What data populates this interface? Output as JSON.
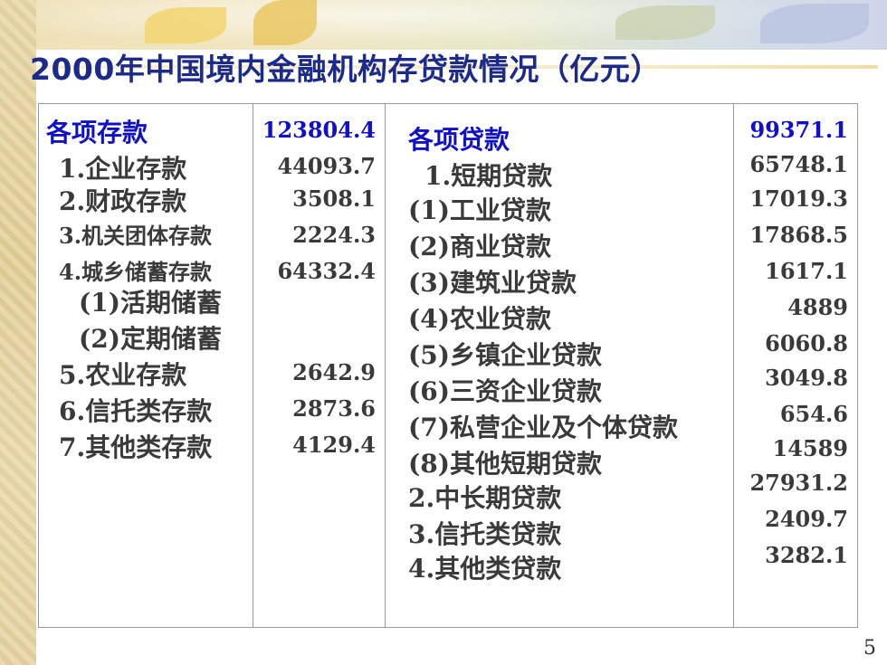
{
  "slide": {
    "title": "2000年中国境内金融机构存贷款情况（亿元）",
    "page_number": "5"
  },
  "deposits": {
    "rows": [
      {
        "label": "各项存款",
        "value": "123804.4",
        "style": "header"
      },
      {
        "label": "1.企业存款",
        "value": "44093.7",
        "style": "normal"
      },
      {
        "label": "2.财政存款",
        "value": "3508.1",
        "style": "normal"
      },
      {
        "label": "3.机关团体存款",
        "value": "2224.3",
        "style": "normal"
      },
      {
        "label": "4.城乡储蓄存款",
        "value": "64332.4",
        "style": "normal"
      },
      {
        "label": "(1)活期储蓄",
        "value": "",
        "style": "normal"
      },
      {
        "label": "(2)定期储蓄",
        "value": "",
        "style": "normal"
      },
      {
        "label": "5.农业存款",
        "value": "2642.9",
        "style": "normal"
      },
      {
        "label": "6.信托类存款",
        "value": "2873.6",
        "style": "normal"
      },
      {
        "label": "7.其他类存款",
        "value": "4129.4",
        "style": "normal"
      }
    ]
  },
  "loans": {
    "rows": [
      {
        "label": "各项贷款",
        "value": "99371.1",
        "style": "header"
      },
      {
        "label": "1.短期贷款",
        "value": "65748.1",
        "style": "normal"
      },
      {
        "label": "(1)工业贷款",
        "value": "17019.3",
        "style": "normal"
      },
      {
        "label": "(2)商业贷款",
        "value": "17868.5",
        "style": "normal"
      },
      {
        "label": "(3)建筑业贷款",
        "value": "1617.1",
        "style": "normal"
      },
      {
        "label": "(4)农业贷款",
        "value": "4889",
        "style": "normal"
      },
      {
        "label": "(5)乡镇企业贷款",
        "value": "6060.8",
        "style": "normal"
      },
      {
        "label": "(6)三资企业贷款",
        "value": "3049.8",
        "style": "normal"
      },
      {
        "label": "(7)私营企业及个体贷款",
        "value": "654.6",
        "style": "normal"
      },
      {
        "label": "(8)其他短期贷款",
        "value": "14589",
        "style": "normal"
      },
      {
        "label": "2.中长期贷款",
        "value": "27931.2",
        "style": "normal"
      },
      {
        "label": "3.信托类贷款",
        "value": "2409.7",
        "style": "normal"
      },
      {
        "label": "4.其他类贷款",
        "value": "3282.1",
        "style": "normal"
      }
    ]
  },
  "colors": {
    "title": "#1c2a8a",
    "header_text": "#1010c8",
    "body_text": "#3a3a3a"
  }
}
